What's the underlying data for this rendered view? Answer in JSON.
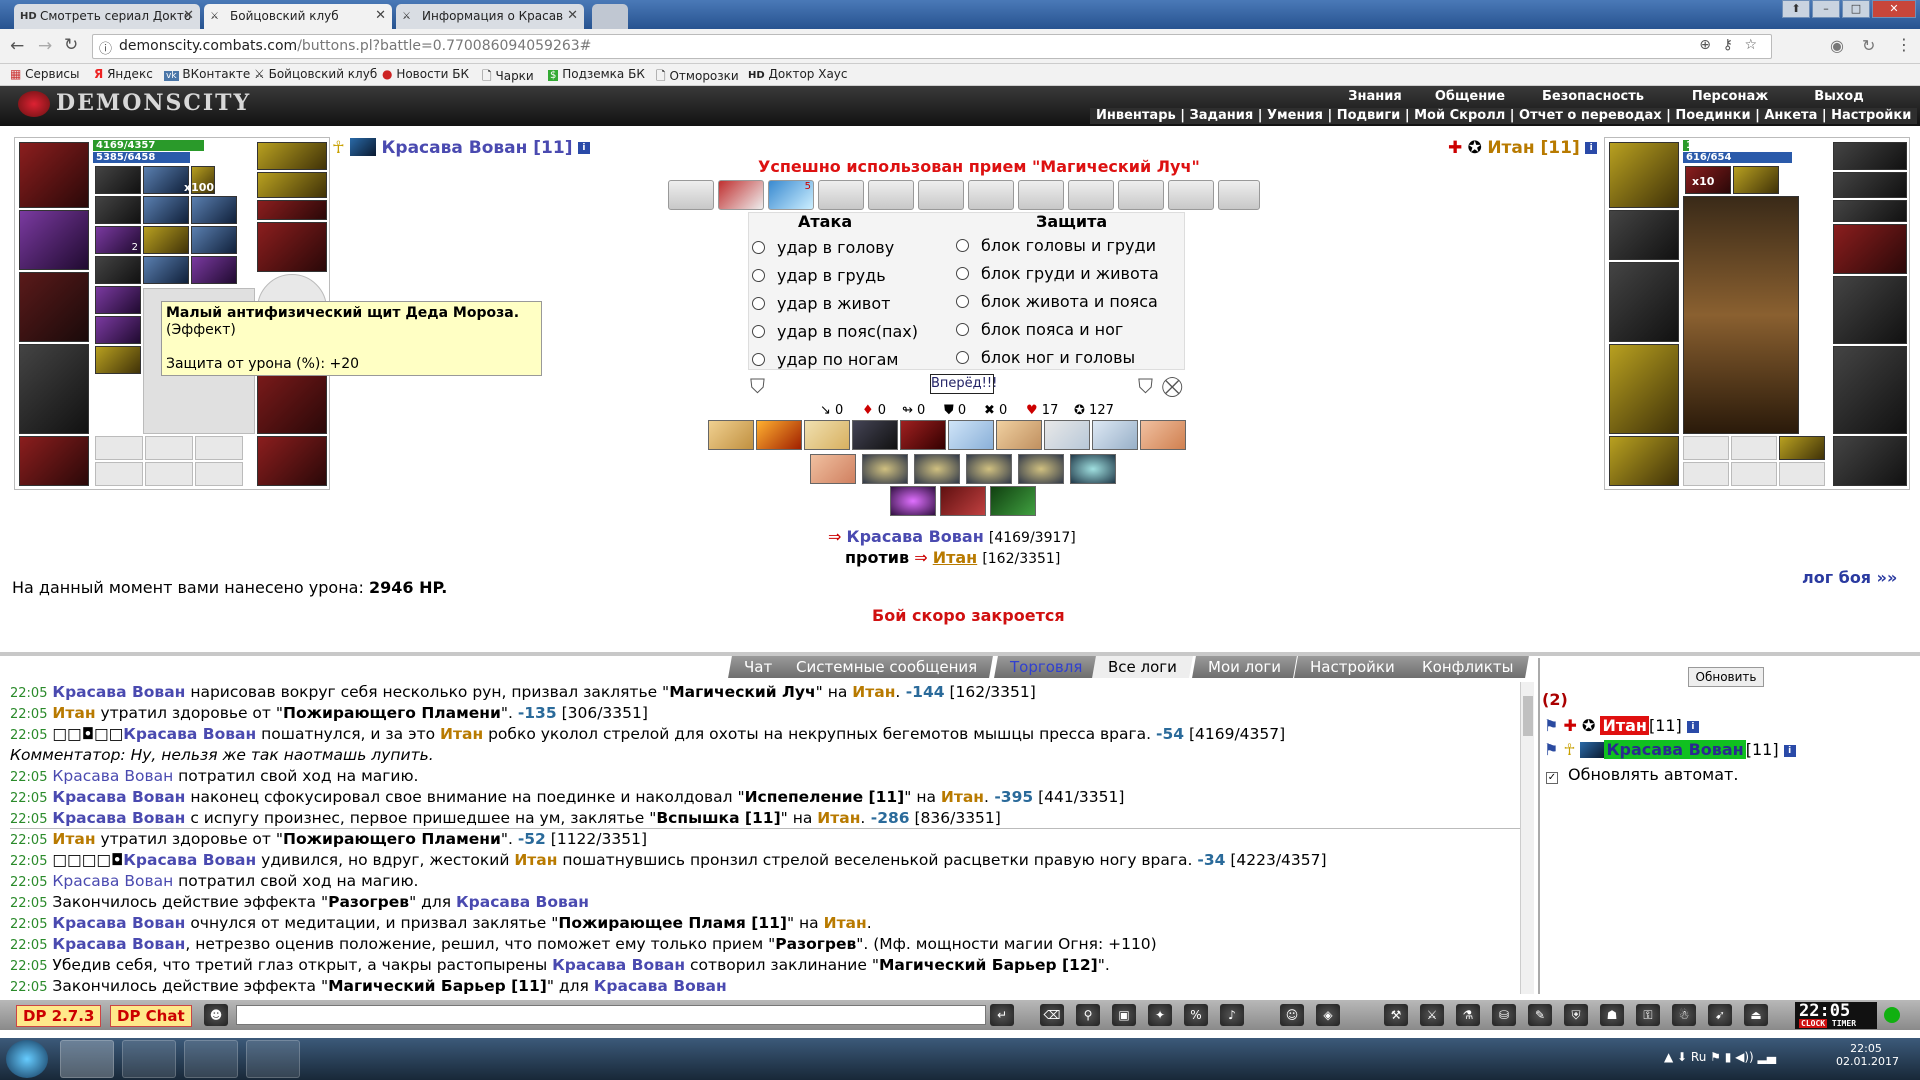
{
  "browser": {
    "tabs": [
      {
        "label": "Смотреть сериал Докто",
        "favicon": "HD",
        "active": false
      },
      {
        "label": "Бойцовский клуб",
        "favicon": "⚔",
        "active": true
      },
      {
        "label": "Информация о Красав",
        "favicon": "⚔",
        "active": false
      }
    ],
    "url_host": "demonscity.combats.com",
    "url_path": "/buttons.pl?battle=0.770086094059263#",
    "bookmarks": [
      "Сервисы",
      "Яндекс",
      "ВКонтакте",
      "Бойцовский клуб",
      "Новости БК",
      "Чарки",
      "Подземка БК",
      "Отморозки",
      "Доктор Хаус"
    ]
  },
  "game": {
    "logo": "DEMONSCITY",
    "main_menu": [
      "Знания",
      "Общение",
      "Безопасность",
      "Персонаж",
      "Выход"
    ],
    "sub_menu": "Инвентарь | Задания | Умения | Подвиги | Мой Скролл | Отчет о переводах | Поединки | Анкета | Настройки",
    "player": {
      "name": "Красава Вован [11]",
      "hp": "4169/4357",
      "mana": "5385/6458",
      "hp_fraction": 0.957,
      "mana_fraction": 0.834,
      "badge_x100": "x100",
      "badge_x2": "2"
    },
    "enemy": {
      "name": "Итан [11]",
      "hp": "162/3351",
      "mana": "616/654",
      "hp_fraction": 0.048,
      "mana_fraction": 0.942,
      "badge_x10": "x10"
    },
    "tooltip": {
      "title": "Малый антифизический щит Деда Мороза.",
      "subtitle": "(Эффект)",
      "detail": "Защита от урона (%): +20"
    },
    "success_message": "Успешно использован прием \"Магический Луч\"",
    "scroll_badge": "5",
    "attack": {
      "header": "Атака",
      "options": [
        "удар в голову",
        "удар в грудь",
        "удар в живот",
        "удар в пояс(пах)",
        "удар по ногам"
      ]
    },
    "defense": {
      "header": "Защита",
      "options": [
        "блок головы и груди",
        "блок груди и живота",
        "блок живота и пояса",
        "блок пояса и ног",
        "блок ног и головы"
      ]
    },
    "forward_button": "Вперёд!!!",
    "stats": [
      {
        "icon": "hit-icon",
        "glyph": "↘",
        "value": "0"
      },
      {
        "icon": "crit-icon",
        "glyph": "♦",
        "value": "0"
      },
      {
        "icon": "dodge-icon",
        "glyph": "↬",
        "value": "0"
      },
      {
        "icon": "block-icon",
        "glyph": "⛊",
        "value": "0"
      },
      {
        "icon": "counter-icon",
        "glyph": "✖",
        "value": "0"
      },
      {
        "icon": "hp-icon",
        "glyph": "♥",
        "value": "17"
      },
      {
        "icon": "spirit-icon",
        "glyph": "✪",
        "value": "127"
      }
    ],
    "versus": {
      "player_name": "Красава Вован",
      "player_hp": "[4169/3917]",
      "vs_label": "против",
      "enemy_name": "Итан",
      "enemy_hp": "[162/3351]"
    },
    "damage_text": "На данный момент вами нанесено урона:",
    "damage_value": "2946 HP.",
    "battle_log_link": "лог боя »»",
    "closing_warning": "Бой скоро закроется"
  },
  "log_tabs": [
    "Чат",
    "Системные сообщения",
    "Торговля",
    "Все логи",
    "Мои логи",
    "Настройки",
    "Конфликты"
  ],
  "log_selected": "Все логи",
  "log": [
    {
      "t": "22:05",
      "parts": [
        [
          "b",
          "Красава Вован"
        ],
        [
          "n",
          " нарисовав вокруг себя несколько рун, призвал заклятье \""
        ],
        [
          "k",
          "Магический Луч"
        ],
        [
          "n",
          "\" на "
        ],
        [
          "g",
          "Итан"
        ],
        [
          "n",
          "."
        ],
        [
          "v",
          " -144"
        ],
        [
          "n",
          " [162/3351]"
        ]
      ]
    },
    {
      "t": "22:05",
      "parts": [
        [
          "g",
          "Итан"
        ],
        [
          "n",
          " утратил здоровье от \""
        ],
        [
          "k",
          "Пожирающего Пламени"
        ],
        [
          "n",
          "\". "
        ],
        [
          "v",
          "-135"
        ],
        [
          "n",
          " [306/3351]"
        ]
      ]
    },
    {
      "t": "22:05",
      "parts": [
        [
          "n",
          "□□◘□□"
        ],
        [
          "b",
          "Красава Вован"
        ],
        [
          "n",
          " пошатнулся, и за это "
        ],
        [
          "g",
          "Итан"
        ],
        [
          "n",
          " робко уколол стрелой для охоты на некрупных бегемотов мышцы пресса врага. "
        ],
        [
          "v",
          "-54"
        ],
        [
          "n",
          " [4169/4357]"
        ]
      ]
    },
    {
      "t": "",
      "parts": [
        [
          "c",
          "Комментатор: Ну, нельзя же так наотмашь лупить."
        ]
      ]
    },
    {
      "t": "22:05",
      "parts": [
        [
          "bn",
          "Красава Вован"
        ],
        [
          "n",
          " потратил свой ход на магию."
        ]
      ]
    },
    {
      "t": "22:05",
      "parts": [
        [
          "b",
          "Красава Вован"
        ],
        [
          "n",
          " наконец сфокусировал свое внимание на поединке и наколдовал \""
        ],
        [
          "k",
          "Испепеление [11]"
        ],
        [
          "n",
          "\" на "
        ],
        [
          "g",
          "Итан"
        ],
        [
          "n",
          "."
        ],
        [
          "v",
          " -395"
        ],
        [
          "n",
          " [441/3351]"
        ]
      ]
    },
    {
      "t": "22:05",
      "parts": [
        [
          "b",
          "Красава Вован"
        ],
        [
          "n",
          " с испугу произнес, первое пришедшее на ум, заклятье \""
        ],
        [
          "k",
          "Вспышка [11]"
        ],
        [
          "n",
          "\" на "
        ],
        [
          "g",
          "Итан"
        ],
        [
          "n",
          "."
        ],
        [
          "v",
          " -286"
        ],
        [
          "n",
          " [836/3351]"
        ]
      ]
    },
    {
      "t": "22:05",
      "parts": [
        [
          "g",
          "Итан"
        ],
        [
          "n",
          " утратил здоровье от \""
        ],
        [
          "k",
          "Пожирающего Пламени"
        ],
        [
          "n",
          "\". "
        ],
        [
          "v",
          "-52"
        ],
        [
          "n",
          " [1122/3351]"
        ]
      ]
    },
    {
      "t": "22:05",
      "parts": [
        [
          "n",
          "□□□□◘"
        ],
        [
          "b",
          "Красава Вован"
        ],
        [
          "n",
          " удивился, но вдруг, жестокий "
        ],
        [
          "g",
          "Итан"
        ],
        [
          "n",
          " пошатнувшись пронзил стрелой веселенькой расцветки правую ногу врага. "
        ],
        [
          "v",
          "-34"
        ],
        [
          "n",
          " [4223/4357]"
        ]
      ]
    },
    {
      "t": "22:05",
      "parts": [
        [
          "bn",
          "Красава Вован"
        ],
        [
          "n",
          " потратил свой ход на магию."
        ]
      ]
    },
    {
      "t": "22:05",
      "parts": [
        [
          "n",
          "Закончилось действие эффекта \""
        ],
        [
          "k",
          "Разогрев"
        ],
        [
          "n",
          "\" для "
        ],
        [
          "b",
          "Красава Вован"
        ]
      ]
    },
    {
      "t": "22:05",
      "parts": [
        [
          "b",
          "Красава Вован"
        ],
        [
          "n",
          " очнулся от медитации, и призвал заклятье \""
        ],
        [
          "k",
          "Пожирающее Пламя [11]"
        ],
        [
          "n",
          "\" на "
        ],
        [
          "g",
          "Итан"
        ],
        [
          "n",
          "."
        ]
      ]
    },
    {
      "t": "22:05",
      "parts": [
        [
          "b",
          "Красава Вован"
        ],
        [
          "n",
          ", нетрезво оценив положение, решил, что поможет ему только прием \""
        ],
        [
          "k",
          "Разогрев"
        ],
        [
          "n",
          "\". (Мф. мощности магии Огня: +110)"
        ]
      ]
    },
    {
      "t": "22:05",
      "parts": [
        [
          "n",
          "Убедив себя, что третий глаз открыт, а чакры растопырены "
        ],
        [
          "b",
          "Красава Вован"
        ],
        [
          "n",
          " сотворил заклинание \""
        ],
        [
          "k",
          "Магический Барьер [12]"
        ],
        [
          "n",
          "\"."
        ]
      ]
    },
    {
      "t": "22:05",
      "parts": [
        [
          "n",
          "Закончилось действие эффекта \""
        ],
        [
          "k",
          "Магический Барьер [11]"
        ],
        [
          "n",
          "\" для "
        ],
        [
          "b",
          "Красава Вован"
        ]
      ]
    }
  ],
  "right_panel": {
    "refresh_button": "Обновить",
    "count": "(2)",
    "enemy_entry": "Итан",
    "player_entry": "Красава Вован",
    "level": "[11]",
    "auto_refresh_label": "Обновлять автомат."
  },
  "bottom": {
    "dp_version": "DP 2.7.3",
    "dp_chat": "DP Chat",
    "clock": "22:05",
    "clock_label": "CLOCK",
    "timer_label": "TIMER"
  },
  "taskbar": {
    "time": "22:05",
    "date": "02.01.2017",
    "lang": "Ru"
  }
}
